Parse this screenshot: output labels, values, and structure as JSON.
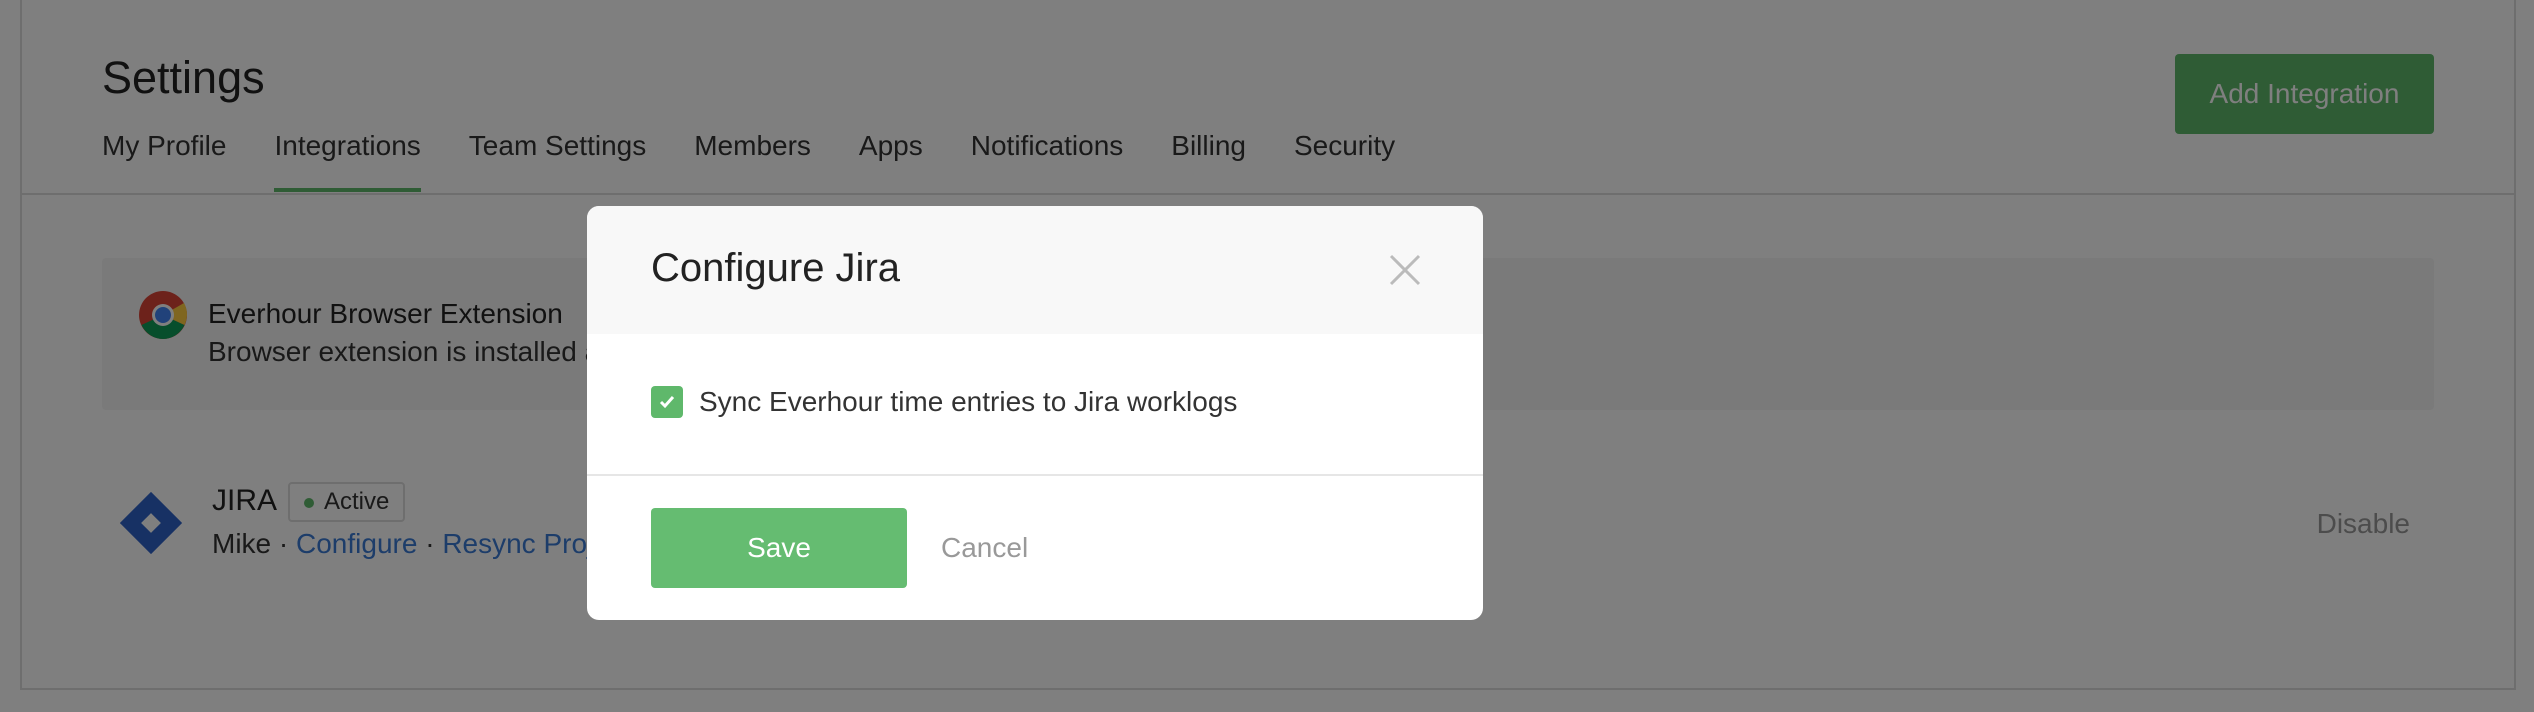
{
  "header": {
    "title": "Settings",
    "add_integration_label": "Add Integration"
  },
  "tabs": [
    {
      "label": "My Profile",
      "active": false
    },
    {
      "label": "Integrations",
      "active": true
    },
    {
      "label": "Team Settings",
      "active": false
    },
    {
      "label": "Members",
      "active": false
    },
    {
      "label": "Apps",
      "active": false
    },
    {
      "label": "Notifications",
      "active": false
    },
    {
      "label": "Billing",
      "active": false
    },
    {
      "label": "Security",
      "active": false
    }
  ],
  "extension": {
    "icon": "chrome-icon",
    "title": "Everhour Browser Extension",
    "description": "Browser extension is installed a"
  },
  "jira": {
    "name": "JIRA",
    "status": "Active",
    "user": "Mike",
    "separator": "·",
    "configure_label": "Configure",
    "resync_label": "Resync Proj",
    "disable_label": "Disable"
  },
  "modal": {
    "title": "Configure Jira",
    "sync_label": "Sync Everhour time entries to Jira worklogs",
    "sync_checked": true,
    "save_label": "Save",
    "cancel_label": "Cancel"
  },
  "colors": {
    "accent": "#5fb86b",
    "link": "#3a7bd5",
    "overlay": "rgba(0,0,0,0.5)"
  }
}
